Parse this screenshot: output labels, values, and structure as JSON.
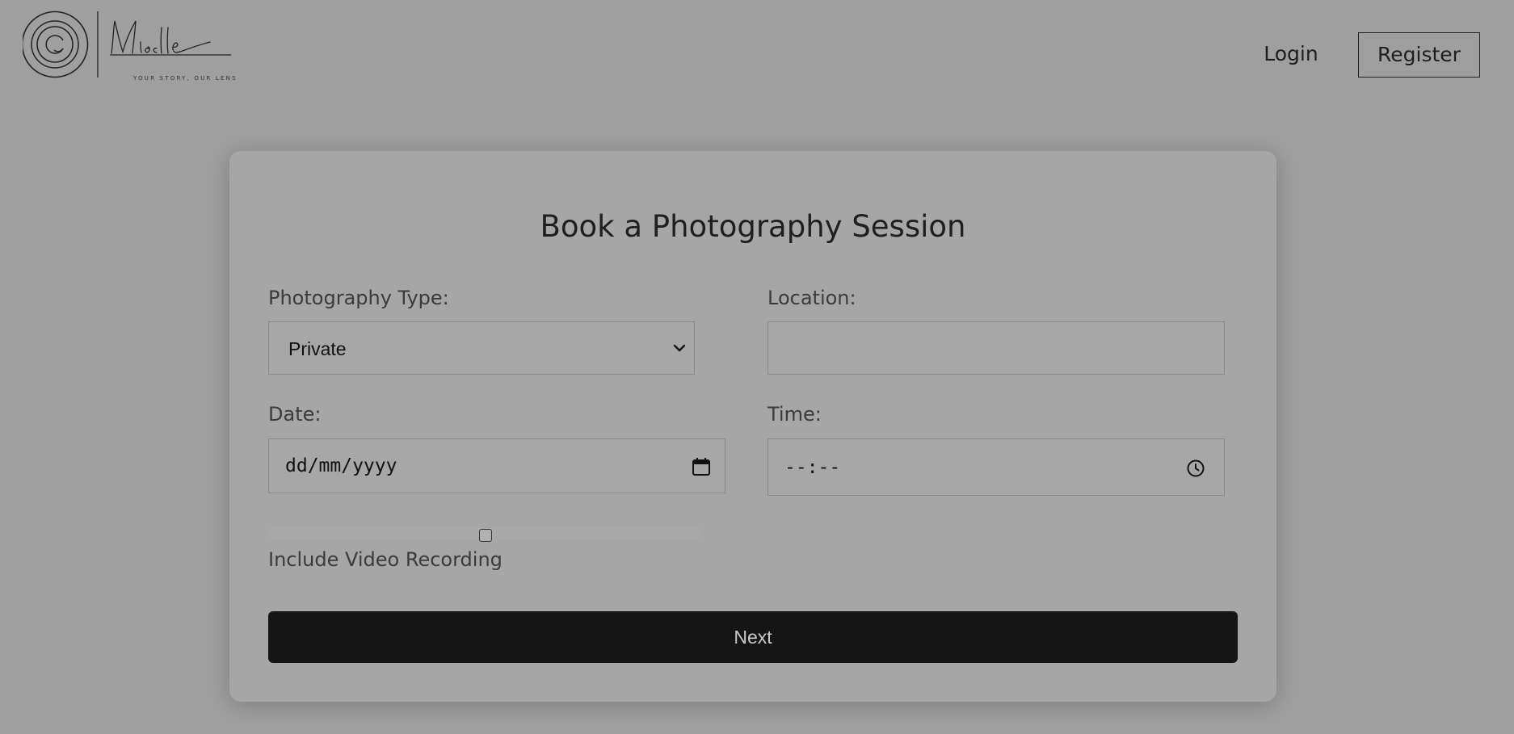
{
  "header": {
    "logo": {
      "signature_text": "Mielle",
      "tagline": "YOUR STORY, OUR LENS"
    },
    "nav": {
      "login_label": "Login",
      "register_label": "Register"
    }
  },
  "form": {
    "title": "Book a Photography Session",
    "photography_type": {
      "label": "Photography Type:",
      "selected_value": "Private",
      "icon": "chevron-down-icon"
    },
    "location": {
      "label": "Location:",
      "value": ""
    },
    "date": {
      "label": "Date:",
      "placeholder": "dd/mm/yyyy",
      "icon": "calendar-icon"
    },
    "time": {
      "label": "Time:",
      "placeholder": "--:--",
      "icon": "clock-icon"
    },
    "video_recording": {
      "label": "Include Video Recording",
      "checked": false
    },
    "next_label": "Next"
  },
  "colors": {
    "page_background": "#9f9f9f",
    "card_background": "#a6a6a6",
    "primary_button": "#151515",
    "primary_button_text": "#c9c9c9"
  }
}
